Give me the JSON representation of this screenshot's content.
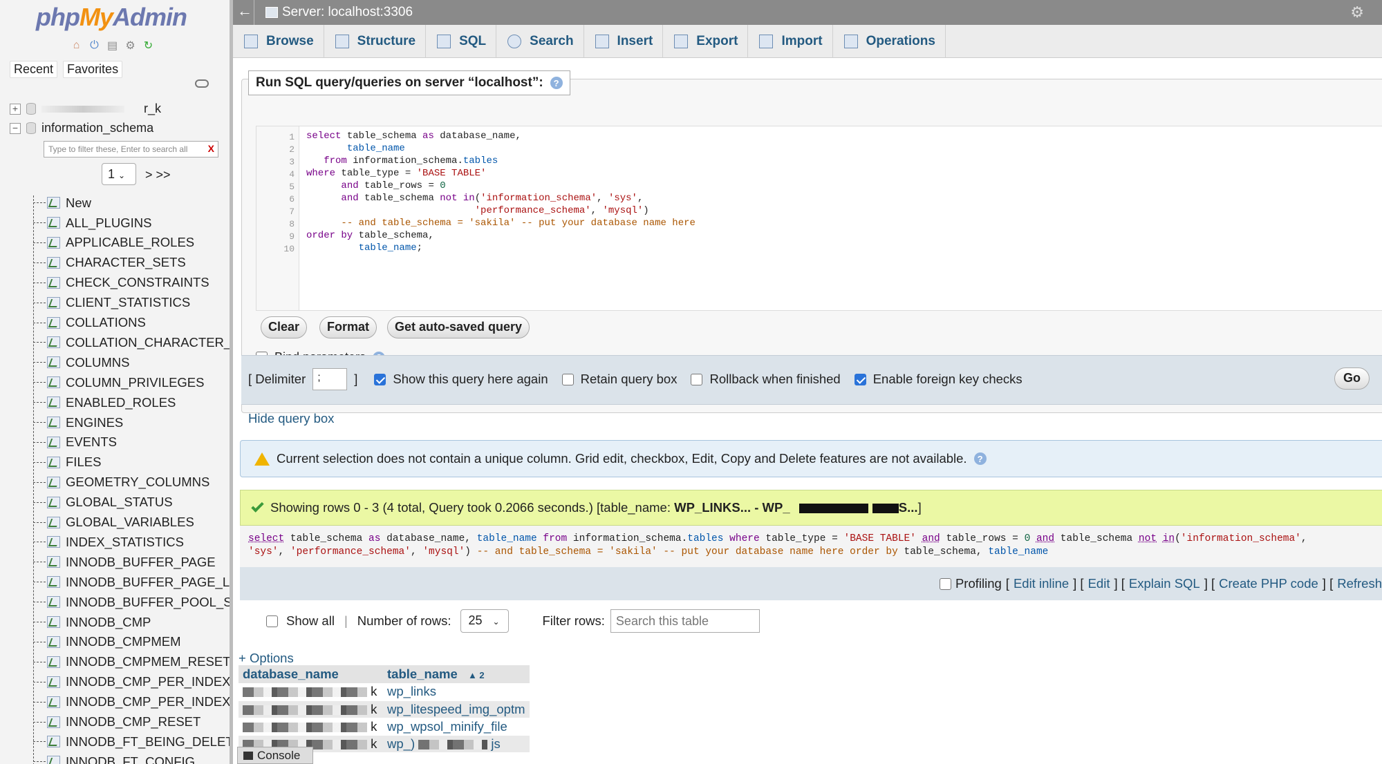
{
  "logo": {
    "php": "php",
    "my": "My",
    "admin": "Admin"
  },
  "nav": {
    "recent": "Recent",
    "favorites": "Favorites",
    "db_redacted_suffix": "r_k",
    "db_current": "information_schema",
    "filter_placeholder": "Type to filter these, Enter to search all",
    "filter_clear": "X",
    "page_value": "1",
    "page_next": "> >>",
    "new_label": "New",
    "tables": [
      "ALL_PLUGINS",
      "APPLICABLE_ROLES",
      "CHARACTER_SETS",
      "CHECK_CONSTRAINTS",
      "CLIENT_STATISTICS",
      "COLLATIONS",
      "COLLATION_CHARACTER_S",
      "COLUMNS",
      "COLUMN_PRIVILEGES",
      "ENABLED_ROLES",
      "ENGINES",
      "EVENTS",
      "FILES",
      "GEOMETRY_COLUMNS",
      "GLOBAL_STATUS",
      "GLOBAL_VARIABLES",
      "INDEX_STATISTICS",
      "INNODB_BUFFER_PAGE",
      "INNODB_BUFFER_PAGE_LF",
      "INNODB_BUFFER_POOL_ST",
      "INNODB_CMP",
      "INNODB_CMPMEM",
      "INNODB_CMPMEM_RESET",
      "INNODB_CMP_PER_INDEX",
      "INNODB_CMP_PER_INDEX_",
      "INNODB_CMP_RESET",
      "INNODB_FT_BEING_DELET",
      "INNODB_FT_CONFIG"
    ]
  },
  "topbar": {
    "back": "←",
    "server_title": "Server: localhost:3306"
  },
  "tabs": [
    "Browse",
    "Structure",
    "SQL",
    "Search",
    "Insert",
    "Export",
    "Import",
    "Operations"
  ],
  "sql_box": {
    "legend": "Run SQL query/queries on server “localhost”:",
    "help": "?",
    "line_numbers": [
      "1",
      "2",
      "3",
      "4",
      "5",
      "6",
      "7",
      "8",
      "9",
      "10"
    ],
    "buttons": {
      "clear": "Clear",
      "format": "Format",
      "autosaved": "Get auto-saved query"
    },
    "bind_params": "Bind parameters"
  },
  "options": {
    "delimiter_open": "[ Delimiter",
    "delimiter_value": ";",
    "delimiter_close": "]",
    "show_query": "Show this query here again",
    "retain": "Retain query box",
    "rollback": "Rollback when finished",
    "fk_checks": "Enable foreign key checks",
    "go": "Go"
  },
  "hide_query": "Hide query box",
  "notice": "Current selection does not contain a unique column. Grid edit, checkbox, Edit, Copy and Delete features are not available.",
  "success": {
    "prefix": "Showing rows 0 - 3 (4 total, Query took 0.2066 seconds.) [table_name: ",
    "bold_start": "WP_LINKS... - WP_",
    "bold_end": "S...",
    "suffix": "]"
  },
  "profiling": {
    "label": "Profiling",
    "edit_inline": "Edit inline",
    "edit": "Edit",
    "explain": "Explain SQL",
    "php_code": "Create PHP code",
    "refresh": "Refresh"
  },
  "rows_ctrl": {
    "show_all": "Show all",
    "number_rows": "Number of rows:",
    "rows_value": "25",
    "filter": "Filter rows:",
    "search_placeholder": "Search this table"
  },
  "result": {
    "options": "+ Options",
    "col1": "database_name",
    "col2": "table_name",
    "sort": "▲ 2",
    "rows": [
      {
        "db": "k",
        "table": "wp_links"
      },
      {
        "db": "k",
        "table": "wp_litespeed_img_optm"
      },
      {
        "db": "k",
        "table": "wp_wpsol_minify_file"
      },
      {
        "db": "k",
        "table": "wp_)"
      }
    ],
    "last_row_suffix": "js"
  },
  "console": "Console"
}
